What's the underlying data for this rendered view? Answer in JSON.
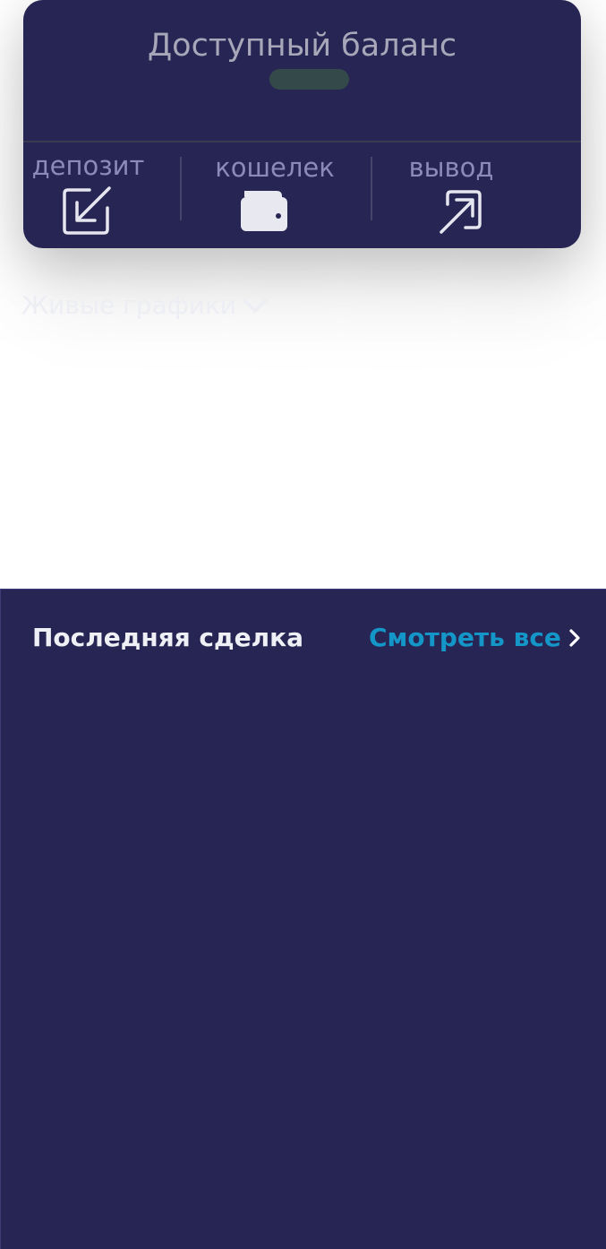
{
  "balance": {
    "title": "Доступный баланс"
  },
  "actions": [
    {
      "label": "депозит",
      "icon": "deposit-icon"
    },
    {
      "label": "кошелек",
      "icon": "wallet-icon"
    },
    {
      "label": "вывод",
      "icon": "withdraw-icon"
    }
  ],
  "live_charts": {
    "label": "Живые графики",
    "icon": "chevron-down-icon"
  },
  "last_trade": {
    "title": "Последняя сделка",
    "view_all": "Смотреть все",
    "view_all_icon": "chevron-right-icon"
  },
  "colors": {
    "card_background": "#262553",
    "action_label": "#8c8bb8",
    "link_accent": "#1596c8",
    "balance_placeholder": "#344a4a"
  }
}
